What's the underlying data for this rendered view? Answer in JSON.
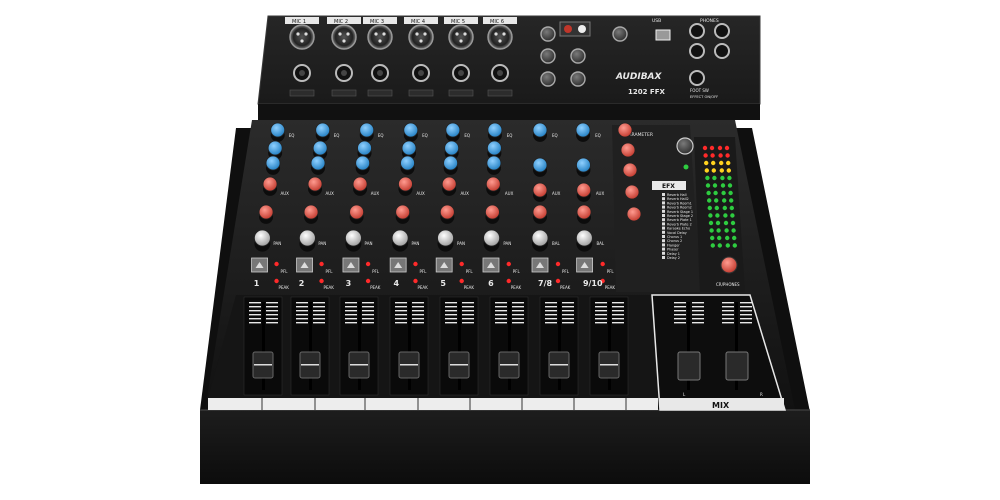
{
  "brand": {
    "logo_text": "AUDIBAX",
    "model": "1202 FFX"
  },
  "top_panel": {
    "mic_labels": [
      "MIC 1",
      "MIC 2",
      "MIC 3",
      "MIC 4",
      "MIC 5",
      "MIC 6"
    ],
    "right_labels": [
      "PHONES",
      "USB",
      "FOOT SW",
      "EFFECT ON/OFF"
    ]
  },
  "channels": [
    {
      "number": "1",
      "pan": "PAN"
    },
    {
      "number": "2",
      "pan": "PAN"
    },
    {
      "number": "3",
      "pan": "PAN"
    },
    {
      "number": "4",
      "pan": "PAN"
    },
    {
      "number": "5",
      "pan": "PAN"
    },
    {
      "number": "6",
      "pan": "PAN"
    },
    {
      "number": "7/8",
      "pan": "BAL"
    },
    {
      "number": "9/10",
      "pan": "BAL"
    }
  ],
  "strip_labels": {
    "eq": "EQ",
    "aux": "AUX",
    "pfl": "PFL",
    "peak": "PEAK"
  },
  "efx": {
    "title": "EFX",
    "parameter": "PARAMETER",
    "presets": [
      "Reverb Hall",
      "Reverb Hall2",
      "Reverb Room1",
      "Reverb Room2",
      "Reverb Stage 1",
      "Reverb Stage 2",
      "Reverb Plate 1",
      "Reverb Plate 2",
      "Karaoke Echo",
      "Vocal Delay",
      "Chorus 1",
      "Chorus 2",
      "Flanger",
      "Phaser",
      "Delay 1",
      "Delay 2"
    ]
  },
  "master": {
    "label": "MIX",
    "left": "L",
    "right": "R",
    "meter_label": "CR/PHONES"
  },
  "colors": {
    "body": "#1c1c1c",
    "panel": "#2a2a2a",
    "knob_blue": "#3aa0e0",
    "knob_red": "#e0473a",
    "knob_white": "#e6e6e6",
    "led_green": "#2ecc40",
    "led_yellow": "#ffd21f",
    "led_red": "#ff2a2a"
  }
}
